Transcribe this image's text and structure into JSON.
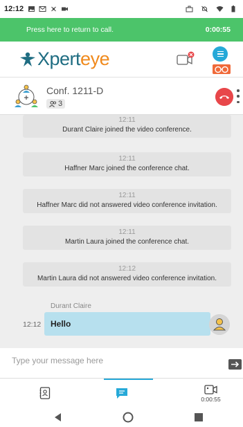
{
  "status_bar": {
    "time": "12:12",
    "icons": [
      "image-icon",
      "gmail-icon",
      "signal-icon",
      "camera-icon",
      "work-icon",
      "mute-icon",
      "wifi-icon",
      "battery-icon"
    ]
  },
  "call_banner": {
    "text": "Press here to return to call.",
    "timer": "0:00:55",
    "color": "#4cc46a"
  },
  "brand": {
    "logo_text_1": "Xpert",
    "logo_text_2": "eye",
    "accent": "#26a9d8",
    "brand_blue": "#1f6d82",
    "brand_orange": "#f08a1d"
  },
  "conference": {
    "name": "Conf. 1211-D",
    "participants": "3"
  },
  "messages": [
    {
      "time": "12:11",
      "text": "Durant Claire joined the video conference."
    },
    {
      "time": "12:11",
      "text": "Haffner Marc joined the conference chat."
    },
    {
      "time": "12:11",
      "text": "Haffner Marc did not answered video conference invitation."
    },
    {
      "time": "12:11",
      "text": "Martin Laura joined the conference chat."
    },
    {
      "time": "12:12",
      "text": "Martin Laura did not answered video conference invitation."
    }
  ],
  "chat_message": {
    "sender": "Durant Claire",
    "time": "12:12",
    "text": "Hello"
  },
  "input": {
    "placeholder": "Type your message here"
  },
  "tabs": [
    {
      "icon": "contacts-icon"
    },
    {
      "icon": "chat-icon"
    },
    {
      "icon": "video-call-icon",
      "label": "0:00:55"
    }
  ]
}
